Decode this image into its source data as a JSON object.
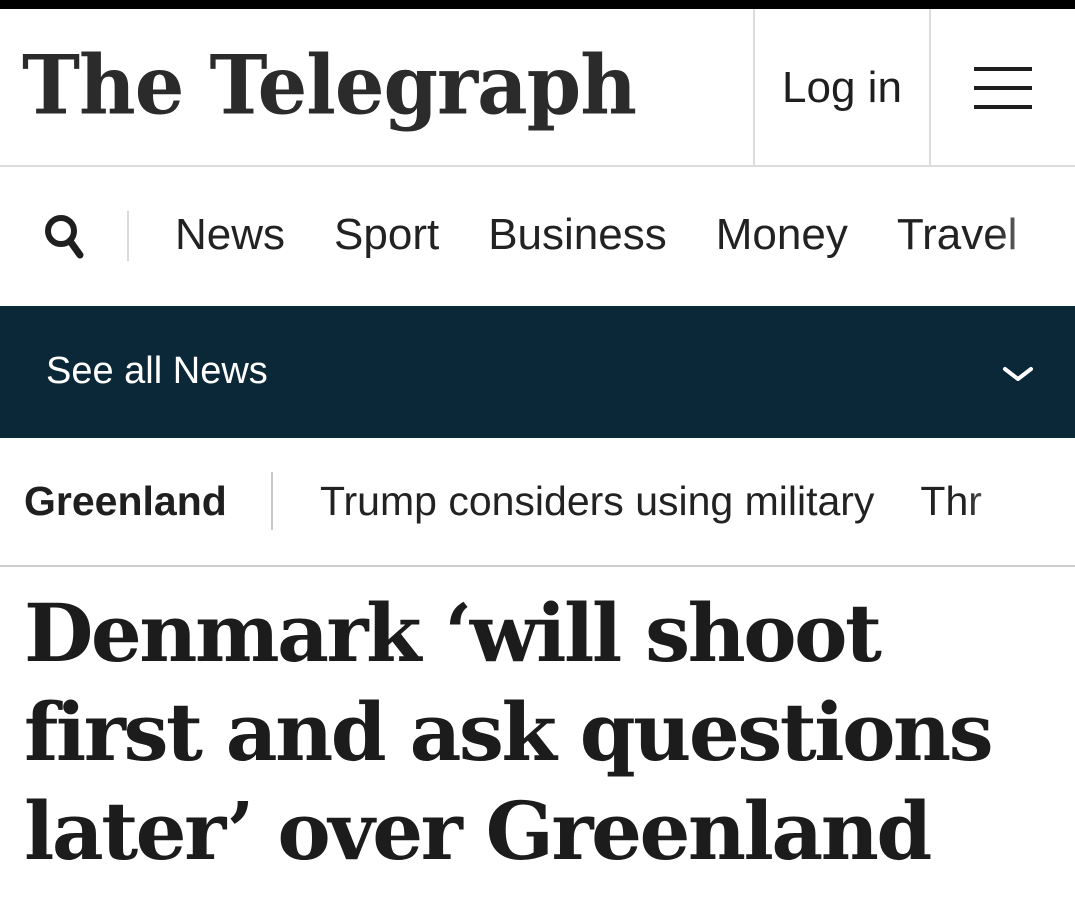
{
  "header": {
    "logo_text": "The Telegraph",
    "login_label": "Log in",
    "menu_icon": "hamburger-menu-icon"
  },
  "nav": {
    "search_icon": "search-icon",
    "items": [
      {
        "label": "News"
      },
      {
        "label": "Sport"
      },
      {
        "label": "Business"
      },
      {
        "label": "Money"
      },
      {
        "label": "Travel"
      }
    ]
  },
  "section_bar": {
    "label": "See all News",
    "icon": "chevron-down-icon",
    "background": "#0b2838"
  },
  "topics": {
    "tag": "Greenland",
    "links": [
      {
        "label": "Trump considers using military"
      },
      {
        "label": "Thr"
      }
    ]
  },
  "article": {
    "headline": "Denmark ‘will shoot first and ask questions later’ over Greenland"
  }
}
